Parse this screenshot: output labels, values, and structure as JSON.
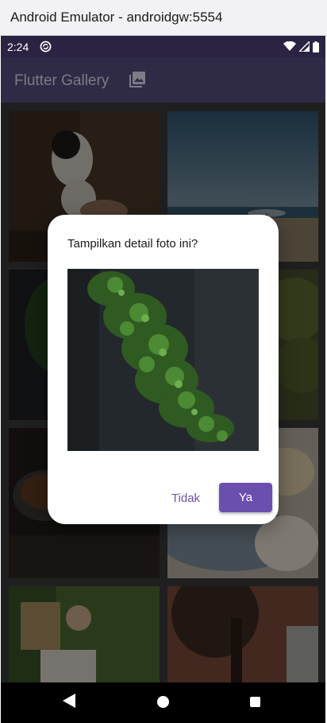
{
  "window": {
    "title": "Android Emulator - androidgw:5554"
  },
  "status_bar": {
    "time": "2:24",
    "icons": [
      "sync-icon",
      "wifi-icon",
      "signal-icon",
      "battery-icon"
    ]
  },
  "app_bar": {
    "title": "Flutter Gallery",
    "icon": "photo-library-icon"
  },
  "gallery": {
    "photos": [
      "cat",
      "beach",
      "kale",
      "trees",
      "pan",
      "pastry",
      "reading",
      "tree"
    ]
  },
  "dialog": {
    "title": "Tampilkan detail foto ini?",
    "image": "kale",
    "cancel_label": "Tidak",
    "confirm_label": "Ya"
  },
  "nav_bar": {
    "buttons": [
      "back",
      "home",
      "recents"
    ]
  },
  "colors": {
    "accent": "#6b4fae",
    "app_bar": "#2f2a46",
    "status_bar": "#2a2342"
  }
}
